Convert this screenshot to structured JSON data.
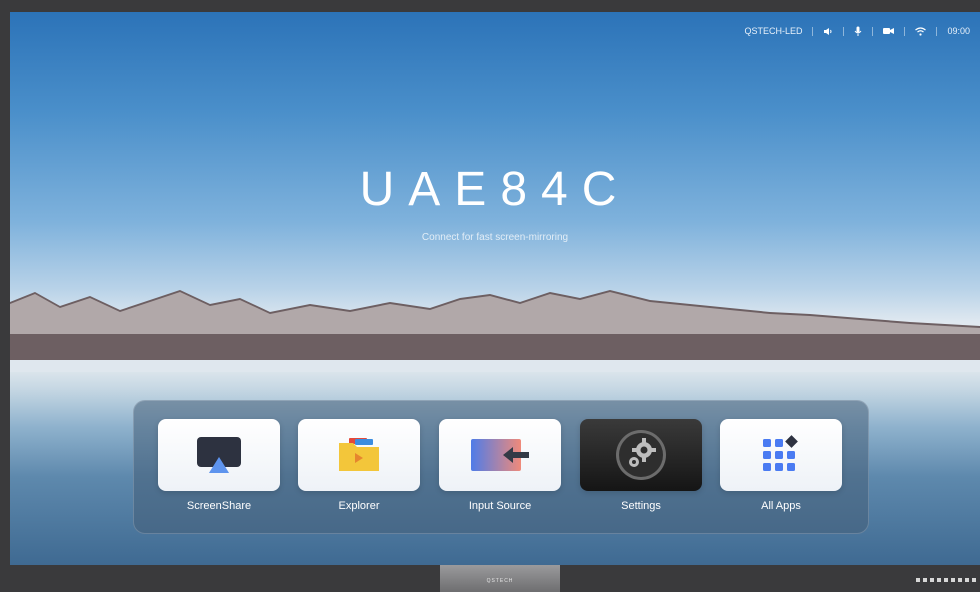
{
  "hero": {
    "title": "UAE84C",
    "subtitle": "Connect for fast screen-mirroring"
  },
  "status_bar": {
    "device_name": "QSTECH-LED",
    "time": "09:00",
    "icons": [
      "speaker-icon",
      "microphone-icon",
      "camera-icon",
      "wifi-icon"
    ]
  },
  "dock": {
    "apps": [
      {
        "label": "ScreenShare",
        "icon": "screenshare-icon"
      },
      {
        "label": "Explorer",
        "icon": "folder-icon"
      },
      {
        "label": "Input Source",
        "icon": "input-source-icon"
      },
      {
        "label": "Settings",
        "icon": "gear-icon"
      },
      {
        "label": "All Apps",
        "icon": "apps-grid-icon"
      }
    ]
  },
  "hardware": {
    "brand": "QSTECH"
  },
  "colors": {
    "sky_top": "#2c73b8",
    "accent_blue": "#3b7be0",
    "folder_yellow": "#f3c63a",
    "apps_blue": "#4a7bf2"
  }
}
